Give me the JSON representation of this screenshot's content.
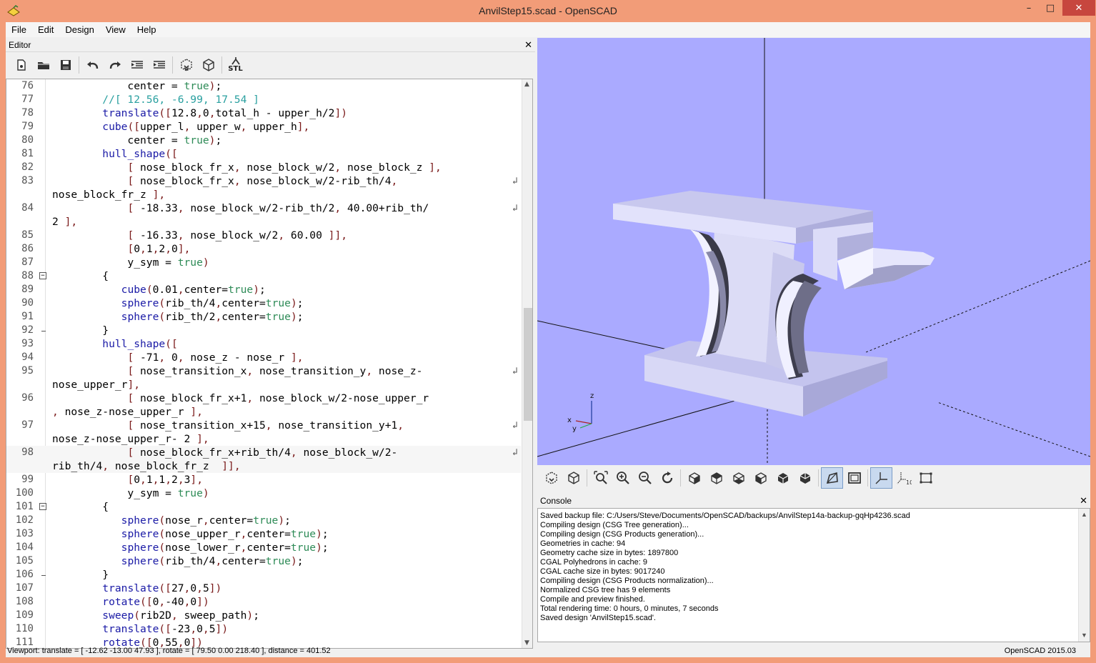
{
  "window": {
    "title": "AnvilStep15.scad - OpenSCAD",
    "minimize": "–",
    "maximize": "□",
    "close": "✕"
  },
  "menu": [
    "File",
    "Edit",
    "Design",
    "View",
    "Help"
  ],
  "editor": {
    "title": "Editor",
    "close": "✕",
    "toolbar_icons": [
      "new-file-icon",
      "open-file-icon",
      "save-icon",
      "undo-icon",
      "redo-icon",
      "unindent-icon",
      "indent-icon",
      "preview-icon",
      "render-icon",
      "export-stl-icon"
    ],
    "stl_label": "STL",
    "lines": [
      {
        "n": "76",
        "code": "            center = true);"
      },
      {
        "n": "77",
        "code": "        //[ 12.56, -6.99, 17.54 ]"
      },
      {
        "n": "78",
        "code": "        translate([12.8,0,total_h - upper_h/2])"
      },
      {
        "n": "79",
        "code": "        cube([upper_l, upper_w, upper_h],"
      },
      {
        "n": "80",
        "code": "            center = true);"
      },
      {
        "n": "81",
        "code": "        hull_shape(["
      },
      {
        "n": "82",
        "code": "            [ nose_block_fr_x, nose_block_w/2, nose_block_z ],"
      },
      {
        "n": "83",
        "code": "            [ nose_block_fr_x, nose_block_w/2-rib_th/4,",
        "wrap": true
      },
      {
        "n": "",
        "code": "nose_block_fr_z ],"
      },
      {
        "n": "84",
        "code": "            [ -18.33, nose_block_w/2-rib_th/2, 40.00+rib_th/",
        "wrap": true
      },
      {
        "n": "",
        "code": "2 ],"
      },
      {
        "n": "85",
        "code": "            [ -16.33, nose_block_w/2, 60.00 ]],"
      },
      {
        "n": "86",
        "code": "            [0,1,2,0],"
      },
      {
        "n": "87",
        "code": "            y_sym = true)"
      },
      {
        "n": "88",
        "code": "        {",
        "fold": "open"
      },
      {
        "n": "89",
        "code": "           cube(0.01,center=true);"
      },
      {
        "n": "90",
        "code": "           sphere(rib_th/4,center=true);"
      },
      {
        "n": "91",
        "code": "           sphere(rib_th/2,center=true);"
      },
      {
        "n": "92",
        "code": "        }",
        "fold": "end"
      },
      {
        "n": "93",
        "code": "        hull_shape(["
      },
      {
        "n": "94",
        "code": "            [ -71, 0, nose_z - nose_r ],"
      },
      {
        "n": "95",
        "code": "            [ nose_transition_x, nose_transition_y, nose_z-",
        "wrap": true
      },
      {
        "n": "",
        "code": "nose_upper_r],"
      },
      {
        "n": "96",
        "code": "            [ nose_block_fr_x+1, nose_block_w/2-nose_upper_r"
      },
      {
        "n": "",
        "code": ", nose_z-nose_upper_r ],"
      },
      {
        "n": "97",
        "code": "            [ nose_transition_x+15, nose_transition_y+1,",
        "wrap": true
      },
      {
        "n": "",
        "code": "nose_z-nose_upper_r- 2 ],"
      },
      {
        "n": "98",
        "code": "            [ nose_block_fr_x+rib_th/4, nose_block_w/2-",
        "wrap": true,
        "hl": true
      },
      {
        "n": "",
        "code": "rib_th/4, nose_block_fr_z  ]],",
        "hl": true
      },
      {
        "n": "99",
        "code": "            [0,1,1,2,3],"
      },
      {
        "n": "100",
        "code": "            y_sym = true)"
      },
      {
        "n": "101",
        "code": "        {",
        "fold": "open"
      },
      {
        "n": "102",
        "code": "           sphere(nose_r,center=true);"
      },
      {
        "n": "103",
        "code": "           sphere(nose_upper_r,center=true);"
      },
      {
        "n": "104",
        "code": "           sphere(nose_lower_r,center=true);"
      },
      {
        "n": "105",
        "code": "           sphere(rib_th/4,center=true);"
      },
      {
        "n": "106",
        "code": "        }",
        "fold": "end"
      },
      {
        "n": "107",
        "code": "        translate([27,0,5])"
      },
      {
        "n": "108",
        "code": "        rotate([0,-40,0])"
      },
      {
        "n": "109",
        "code": "        sweep(rib2D, sweep_path);"
      },
      {
        "n": "110",
        "code": "        translate([-23,0,5])"
      },
      {
        "n": "111",
        "code": "        rotate([0,55,0])"
      }
    ]
  },
  "viewport": {
    "axis_labels": {
      "z": "z",
      "x": "x",
      "y": "y"
    }
  },
  "view_toolbar_icons": [
    "preview-icon",
    "render-icon",
    "view-all-icon",
    "zoom-in-icon",
    "zoom-out-icon",
    "reset-view-icon",
    "view-right-icon",
    "view-top-icon",
    "view-bottom-icon",
    "view-left-icon",
    "view-front-icon",
    "view-back-icon",
    "perspective-icon",
    "orthogonal-icon",
    "show-axes-icon",
    "show-scale-markers-icon",
    "show-edges-icon"
  ],
  "console": {
    "title": "Console",
    "close": "✕",
    "lines": [
      "Saved backup file: C:/Users/Steve/Documents/OpenSCAD/backups/AnvilStep14a-backup-gqHp4236.scad",
      "Compiling design (CSG Tree generation)...",
      "Compiling design (CSG Products generation)...",
      "Geometries in cache: 94",
      "Geometry cache size in bytes: 1897800",
      "CGAL Polyhedrons in cache: 9",
      "CGAL cache size in bytes: 9017240",
      "Compiling design (CSG Products normalization)...",
      "Normalized CSG tree has 9 elements",
      "Compile and preview finished.",
      "Total rendering time: 0 hours, 0 minutes, 7 seconds",
      "Saved design 'AnvilStep15.scad'."
    ]
  },
  "status": {
    "viewport": "Viewport: translate = [ -12.62 -13.00 47.93 ], rotate = [ 79.50 0.00 218.40 ], distance = 401.52",
    "version": "OpenSCAD 2015.03"
  }
}
